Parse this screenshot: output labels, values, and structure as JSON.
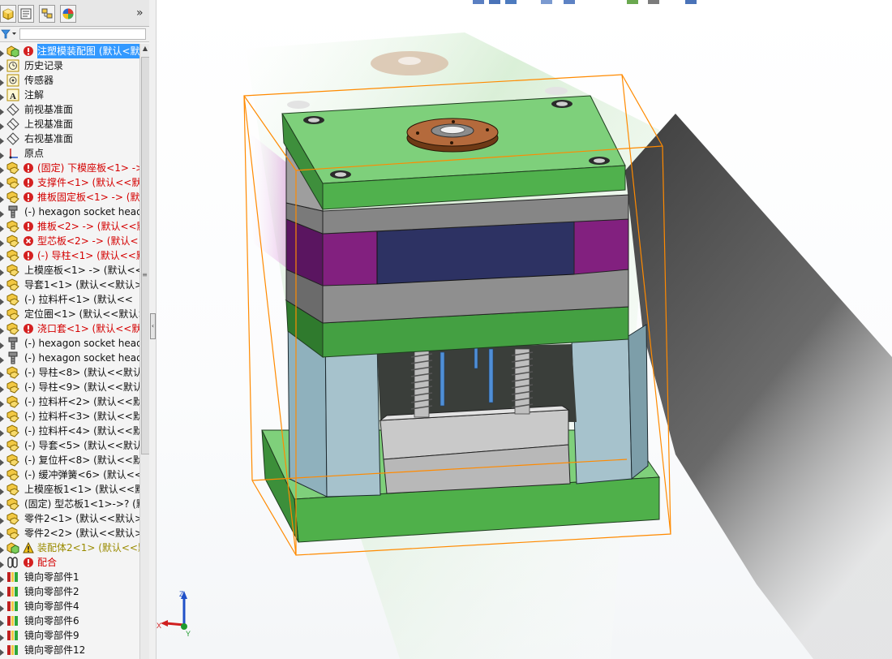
{
  "panel": {
    "tabs": [
      {
        "name": "feature-manager",
        "icon": "cube-tree-icon"
      },
      {
        "name": "property-manager",
        "icon": "property-icon"
      },
      {
        "name": "configuration-manager",
        "icon": "configuration-icon"
      },
      {
        "name": "display-manager",
        "icon": "appearance-icon"
      }
    ],
    "more": "»",
    "filter_icon": "filter-icon"
  },
  "tree": [
    {
      "label": "注塑模装配图 (默认<默认",
      "icon": "assembly-icon",
      "status": "error",
      "color": "selected"
    },
    {
      "label": "历史记录",
      "icon": "history-icon"
    },
    {
      "label": "传感器",
      "icon": "sensor-icon"
    },
    {
      "label": "注解",
      "icon": "annotation-icon"
    },
    {
      "label": "前视基准面",
      "icon": "plane-icon"
    },
    {
      "label": "上视基准面",
      "icon": "plane-icon"
    },
    {
      "label": "右视基准面",
      "icon": "plane-icon"
    },
    {
      "label": "原点",
      "icon": "origin-icon"
    },
    {
      "label": "(固定) 下模座板<1> ->",
      "icon": "part-icon",
      "status": "error",
      "color": "red"
    },
    {
      "label": "支撑件<1> (默认<<默",
      "icon": "part-icon",
      "status": "error",
      "color": "red"
    },
    {
      "label": "推板固定板<1> -> (默",
      "icon": "part-icon",
      "status": "error",
      "color": "red"
    },
    {
      "label": "(-) hexagon socket head",
      "icon": "screw-icon"
    },
    {
      "label": "推板<2> -> (默认<<默",
      "icon": "part-icon",
      "status": "error",
      "color": "red"
    },
    {
      "label": "型芯板<2> -> (默认<",
      "icon": "part-icon",
      "status": "cross",
      "color": "red"
    },
    {
      "label": "(-) 导柱<1> (默认<<默",
      "icon": "part-icon",
      "status": "error",
      "color": "red"
    },
    {
      "label": "上模座板<1> -> (默认<<",
      "icon": "part-icon"
    },
    {
      "label": "导套1<1> (默认<<默认>",
      "icon": "part-icon"
    },
    {
      "label": "(-) 拉料杆<1> (默认<<",
      "icon": "part-icon"
    },
    {
      "label": "定位圈<1> (默认<<默认>",
      "icon": "part-icon"
    },
    {
      "label": "浇口套<1> (默认<<默",
      "icon": "part-icon",
      "status": "error",
      "color": "red"
    },
    {
      "label": "(-) hexagon socket head",
      "icon": "screw-icon"
    },
    {
      "label": "(-) hexagon socket head",
      "icon": "screw-icon"
    },
    {
      "label": "(-) 导柱<8> (默认<<默认",
      "icon": "part-icon"
    },
    {
      "label": "(-) 导柱<9> (默认<<默认",
      "icon": "part-icon"
    },
    {
      "label": "(-) 拉料杆<2> (默认<<默",
      "icon": "part-icon"
    },
    {
      "label": "(-) 拉料杆<3> (默认<<默",
      "icon": "part-icon"
    },
    {
      "label": "(-) 拉料杆<4> (默认<<默",
      "icon": "part-icon"
    },
    {
      "label": "(-) 导套<5> (默认<<默认",
      "icon": "part-icon"
    },
    {
      "label": "(-) 复位杆<8> (默认<<默",
      "icon": "part-icon"
    },
    {
      "label": "(-) 缓冲弹簧<6> (默认<<",
      "icon": "part-icon"
    },
    {
      "label": "上模座板1<1> (默认<<默",
      "icon": "part-icon"
    },
    {
      "label": "(固定) 型芯板1<1>->? (默",
      "icon": "part-icon"
    },
    {
      "label": "零件2<1> (默认<<默认>",
      "icon": "part-icon"
    },
    {
      "label": "零件2<2> (默认<<默认>",
      "icon": "part-icon"
    },
    {
      "label": "装配体2<1> (默认<<默",
      "icon": "subassembly-icon",
      "status": "warning",
      "color": "olive"
    },
    {
      "label": "配合",
      "icon": "mates-icon",
      "status": "error",
      "color": "red"
    },
    {
      "label": "镜向零部件1",
      "icon": "mirror-icon"
    },
    {
      "label": "镜向零部件2",
      "icon": "mirror-icon"
    },
    {
      "label": "镜向零部件4",
      "icon": "mirror-icon"
    },
    {
      "label": "镜向零部件6",
      "icon": "mirror-icon"
    },
    {
      "label": "镜向零部件9",
      "icon": "mirror-icon"
    },
    {
      "label": "镜向零部件12",
      "icon": "mirror-icon"
    }
  ],
  "triad": {
    "x": "X",
    "y": "Y",
    "z": "Z"
  },
  "colors": {
    "selection": "#3399ff",
    "plate_green": "#6fc36c",
    "plate_purple": "#7a1d7a",
    "plate_gray": "#8c8c8c",
    "cavity_navy": "#2a2f5c",
    "pillar_blue_gray": "#9db6c0",
    "bounding_box": "#ff8a00"
  }
}
